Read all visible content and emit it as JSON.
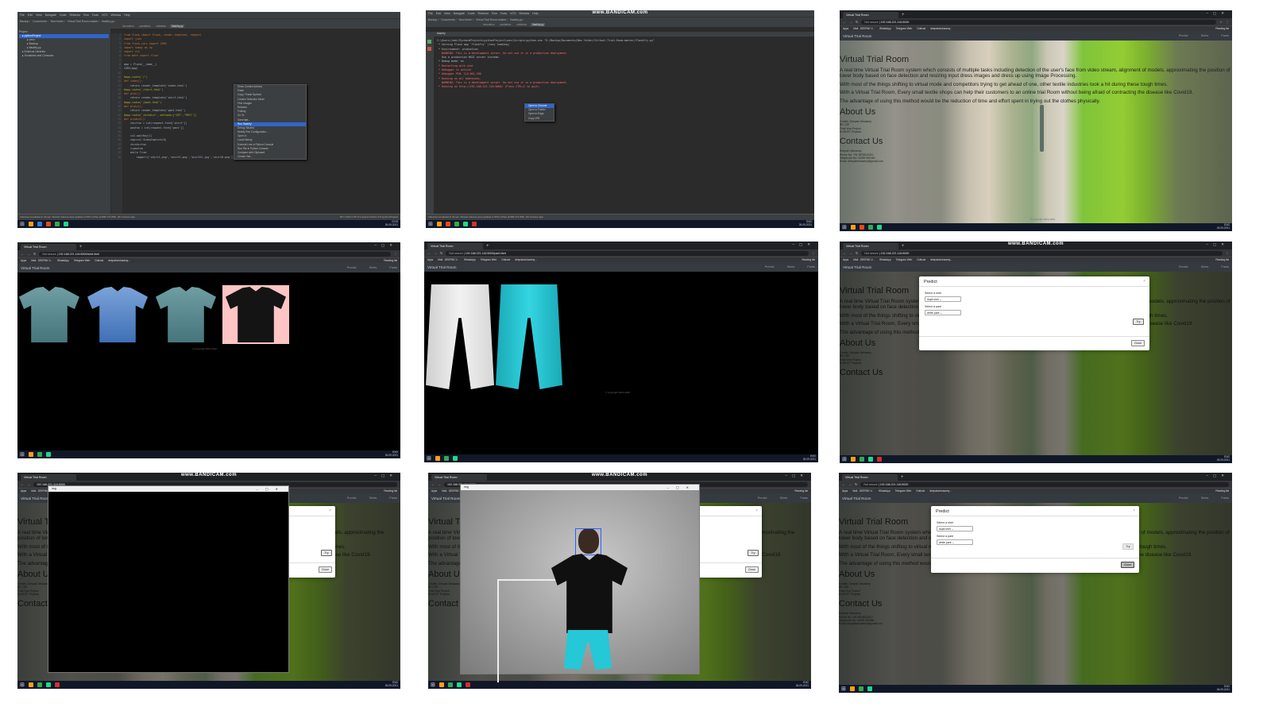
{
  "ide": {
    "menu": [
      "File",
      "Edit",
      "View",
      "Navigate",
      "Code",
      "Refactor",
      "Run",
      "Tools",
      "VCS",
      "Window",
      "Help"
    ],
    "title": "pythonProject - flaskfry.py",
    "breadcrumb": [
      "Backup",
      "Documents",
      "New folder",
      "Virtual Trial Room-master",
      "flaskfry.py"
    ],
    "tabs": [
      "innovation",
      "pantiation",
      "shirtation",
      "flaskfry.py"
    ],
    "project_label": "Project",
    "project_items": [
      "pythonProject",
      "venv",
      "Backup",
      "flaskfry.py",
      "External Libraries",
      "Scratches and Consoles"
    ],
    "code": [
      [
        "kw",
        "from flask import Flask, render_template, request"
      ],
      [
        "kw",
        "import json"
      ],
      [
        "kw",
        "from flask_cors import CORS"
      ],
      [
        "kw",
        "import numpy as np"
      ],
      [
        "kw",
        "import cv2"
      ],
      [
        "kw",
        "from math import floor"
      ],
      [
        "",
        ""
      ],
      [
        "",
        "app = Flask(__name__)"
      ],
      [
        "",
        "CORS(app)"
      ],
      [
        "",
        ""
      ],
      [
        "dec",
        "@app.route('/')"
      ],
      [
        "kw",
        "def index():"
      ],
      [
        "",
        "    return render_template('index.html')"
      ],
      [
        "dec",
        "@app.route('/shirt.html')"
      ],
      [
        "kw",
        "def plot():"
      ],
      [
        "",
        "    return render_template('shirt.html')"
      ],
      [
        "dec",
        "@app.route('/pant.html')"
      ],
      [
        "kw",
        "def ploty():"
      ],
      [
        "",
        "    return render_template('pant.html')"
      ],
      [
        "dec",
        "@app.route('/predict', methods=['GET','POST'])"
      ],
      [
        "kw",
        "def predict():"
      ],
      [
        "",
        "    shirtno = int(request.form['shirt'])"
      ],
      [
        "",
        "    pantno = int(request.form['pant'])"
      ],
      [
        "",
        ""
      ],
      [
        "",
        "    cv2.waitKey(1)"
      ],
      [
        "",
        "    cap=cv2.VideoCapture(0)"
      ],
      [
        "",
        "    ih=shirtno"
      ],
      [
        "",
        "    i=pantno"
      ],
      [
        "",
        "    while True:"
      ],
      [
        "",
        "        imgarr=['shirt1.png','shirt2.png','shirt51.jpg','shirt6.png']"
      ]
    ],
    "context_menu": [
      "Show Context Actions",
      "Paste",
      "Copy / Paste Special",
      "Column Selection Mode",
      "Find Usages",
      "Refactor",
      "Folding",
      "Go To",
      "Generate...",
      "Run 'flaskfry'",
      "Debug 'flaskfry'",
      "Modify Run Configuration...",
      "Open In",
      "Local History",
      "Execute Line in Python Console",
      "Run File in Python Console",
      "Compare with Clipboard",
      "Create Gist..."
    ],
    "context_highlight": 9,
    "status_text": "Indexing completed in 32 sec. Shared indexes were applied to 53% of files (2,808 of 5,308). (46 minutes ago)",
    "status_right": "56:1  CRLF  UTF-8  4 spaces  Python 3.8 (pythonProject)"
  },
  "terminal": {
    "bandicam": "www.BANDICAM.com",
    "run_tab": "flaskfry",
    "lines": [
      [
        "",
        "C:\\Users\\Jodi\\PycharmProjects\\pythonProject\\venv\\Scripts\\python.exe \"E:/Backup/Documents/New folder/Virtual-Trial-Room-master/flaskfry.py\""
      ],
      [
        "",
        " * Serving Flask app 'flaskfry' (lazy loading)"
      ],
      [
        "",
        " * Environment: production"
      ],
      [
        "w",
        "   WARNING: This is a development server. Do not use it in a production deployment."
      ],
      [
        "",
        "   Use a production WSGI server instead."
      ],
      [
        "",
        " * Debug mode: on"
      ],
      [
        "w",
        " * Restarting with stat"
      ],
      [
        "w",
        " * Debugger is active!"
      ],
      [
        "w",
        " * Debugger PIN: 114-801-296"
      ],
      [
        "w",
        " * Running on all addresses."
      ],
      [
        "w",
        "   WARNING: This is a development server. Do not use it in a production deployment."
      ],
      [
        "w",
        " * Running on http://192.168.221.116:5000/ (Press CTRL+C to quit)"
      ]
    ],
    "link_menu": [
      "Open in Chrome",
      "Open in Firefox",
      "Open in Edge",
      "Copy URL"
    ]
  },
  "browser": {
    "tab_title": "Virtual Trial Room",
    "not_secure": "Not secure",
    "url_home": "192.168.221.116:5000",
    "url_shirt": "192.168.221.116:5000/shirt.html",
    "url_pant": "192.168.221.116:5000/pant.html",
    "bookmarks": [
      "Apps",
      "Mail - DEEPAK V...",
      "WhatsApp",
      "Telegram Web",
      "Outlook",
      "deepakvedusamy..."
    ],
    "reading_list": "Reading list"
  },
  "site": {
    "brand": "Virtual Trial Room",
    "nav": [
      "Predict",
      "Shirts",
      "Pants"
    ],
    "heading": "Virtual Trial Room",
    "p1": "A real time Virtual Trial Room system which consists of multiple tasks including detection of the user's face from video stream, alignment of models, approximating the position of lower body based on face detection and resizing input dress images and dress up using Image Processing.",
    "p2": "With most of the things shifting to virtual mode and competitors trying to get ahead of one, other textile industries took a hit during these tough times.",
    "p3": "With a Virtual Trial Room, Every small textile shops can help their customers to an online trial Room without being afraid of contracting the disease like Covid19.",
    "p4": "The advantage of using this method would be the reduction of time and effort spent in trying out the clothes physically.",
    "about_h": "About Us",
    "about_lines": [
      "Credits: Deepak Velusamy",
      "BE CSE",
      "Final Year Project",
      "Dr.MCET Projects"
    ],
    "contact_h": "Contact Us",
    "contact_lines": [
      "Deepak Velusamy",
      "Phone No: +91 9878543210",
      "Telephone No: 04259 952460",
      "Email: deepakvelusamy@gmail.com"
    ],
    "copyright": "© Copyright 2021-2022"
  },
  "modal": {
    "title": "Predict",
    "shirt_label": "Select a shirt",
    "shirt_value": "dupti shirt",
    "pant_label": "Select a pant",
    "pant_value": "white pant",
    "try": "Try",
    "close": "Close"
  },
  "cv_window": {
    "title": "img"
  },
  "taskbar": {
    "time_a": "22:05",
    "date": "26-09-2021",
    "lang": "ENG"
  },
  "colors": {
    "shirt_teal": "#5b8e94",
    "shirt_blue": "#4d7fc3",
    "shirt_black": "#111111",
    "shirt_pink_bg": "#ffc4c4",
    "pant_white": "#e9e9e9",
    "pant_cyan": "#24c8d6"
  }
}
